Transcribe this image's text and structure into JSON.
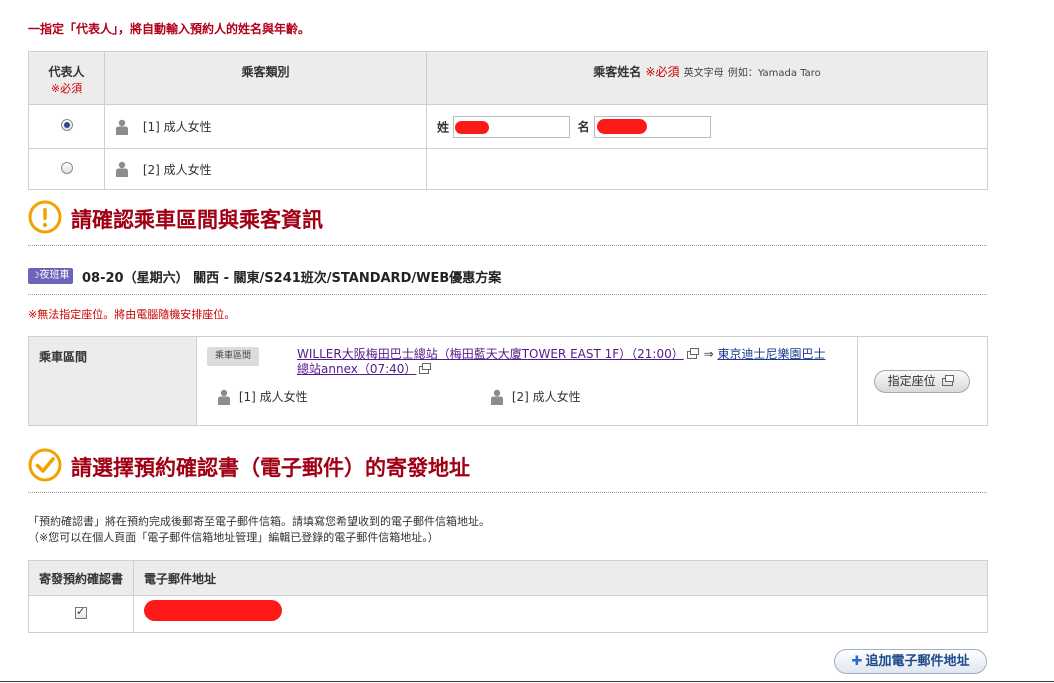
{
  "notice_representative": "一指定「代表人」，將自動輸入預約人的姓名與年齡。",
  "passenger_table": {
    "col_representative": "代表人",
    "col_required": "※必須",
    "col_category": "乘客類別",
    "col_name": "乘客姓名",
    "col_name_required": "※必須",
    "col_name_hint_1": "英文字母",
    "col_name_hint_2": "例如：Yamada Taro",
    "rows": [
      {
        "label": "[1] 成人女性",
        "selected": true,
        "surname_label": "姓",
        "given_label": "名"
      },
      {
        "label": "[2] 成人女性",
        "selected": false
      }
    ]
  },
  "section_confirm": {
    "title": "請確認乘車區間與乘客資訊",
    "icon": "exclamation-circle-icon"
  },
  "trip": {
    "badge": "夜班車",
    "title": "08-20（星期六） 關西 - 關東/S241班次/STANDARD/WEB優惠方案",
    "seat_note": "※無法指定座位。將由電腦隨機安排座位。",
    "segment_header": "乘車區間",
    "segment_tag": "乘車區間",
    "from_stop": "WILLER大阪梅田巴士總站（梅田藍天大廈TOWER EAST 1F）（21:00）",
    "arrow": "⇒",
    "to_stop_part1": "東京迪士尼樂園巴士",
    "to_stop_part2": "總站annex（07:40）",
    "passengers": [
      "[1] 成人女性",
      "[2] 成人女性"
    ],
    "seat_button": "指定座位"
  },
  "section_email": {
    "title": "請選擇預約確認書（電子郵件）的寄發地址",
    "icon": "check-circle-icon"
  },
  "email_desc_1": "「預約確認書」將在預約完成後郵寄至電子郵件信箱。請填寫您希望收到的電子郵件信箱地址。",
  "email_desc_2": "（※您可以在個人頁面「電子郵件信箱地址管理」編輯已登錄的電子郵件信箱地址。）",
  "email_table": {
    "col_send": "寄發預約確認書",
    "col_address": "電子郵件地址",
    "checked": true
  },
  "add_email_button": "追加電子郵件地址",
  "colors": {
    "accent_red": "#a00014",
    "notice_red": "#b3001b",
    "icon_orange": "#f2a100",
    "badge_purple": "#6b64b8"
  }
}
